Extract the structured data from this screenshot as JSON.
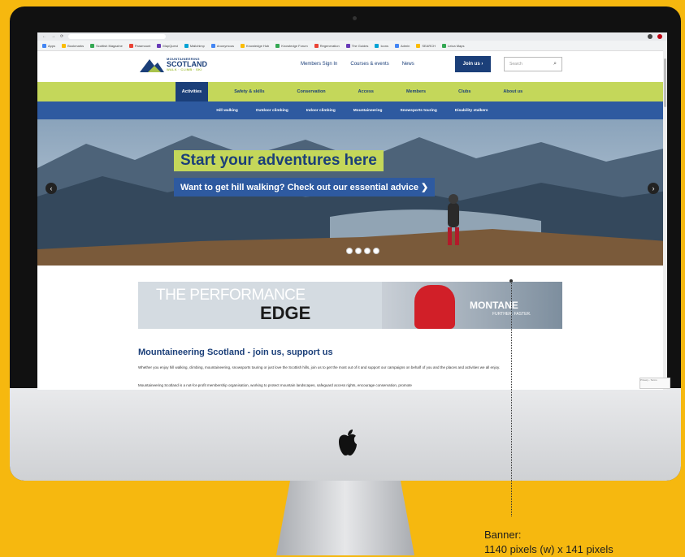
{
  "colors": {
    "background": "#f6b80f",
    "brand_navy": "#1b3f79",
    "brand_lime": "#c4d75a",
    "brand_blue": "#2e5aa0"
  },
  "browser": {
    "bookmarks": [
      "Apps",
      "Bookmarks",
      "Scottish Magazine",
      "Paramount",
      "MapQuest",
      "Mailchimp",
      "Anonymous",
      "Knowledge Hub",
      "Knowledge Forum",
      "Regeneration",
      "The Guides",
      "Icons",
      "Admin",
      "SEARCH",
      "Leica Maps"
    ]
  },
  "site": {
    "logo": {
      "line1": "MOUNTAINEERING",
      "line2": "SCOTLAND",
      "line3": "WALK · CLIMB · SKI"
    },
    "header_links": [
      "Members Sign In",
      "Courses & events",
      "News"
    ],
    "join_label": "Join us ›",
    "search_placeholder": "Search",
    "main_nav": [
      "Activities",
      "Safety & skills",
      "Conservation",
      "Access",
      "Members",
      "Clubs",
      "About us"
    ],
    "sub_nav": [
      "Hill walking",
      "Outdoor climbing",
      "Indoor climbing",
      "Mountaineering",
      "Snowsports touring",
      "Disability stalkers"
    ],
    "hero": {
      "title": "Start your adventures here",
      "subtitle": "Want to get hill walking? Check out our essential advice ❯",
      "prev_icon": "‹",
      "next_icon": "›"
    },
    "banner": {
      "line1": "THE PERFORMANCE",
      "line2": "EDGE",
      "brand": "MONTANE",
      "tagline": "FURTHER. FASTER."
    },
    "section_title": "Mountaineering Scotland - join us, support us",
    "paragraph": "Whether you enjoy hill walking, climbing, mountaineering, snowsports touring or just love the Scottish hills, join us to get the most out of it and support our campaigns on behalf of you and the places and activities we all enjoy.",
    "paragraph2": "Mountaineering Scotland is a not-for-profit membership organisation, working to protect mountain landscapes, safeguard access rights, encourage conservation, promote",
    "recaptcha": "Privacy - Terms"
  },
  "annotation": {
    "label": "Banner:",
    "dimensions": "1140 pixels (w) x 141 pixels"
  }
}
